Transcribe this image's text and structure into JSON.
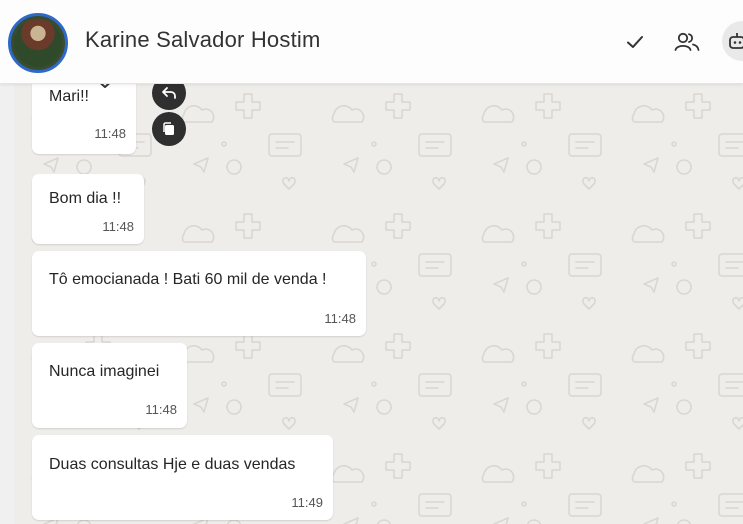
{
  "header": {
    "contact_name": "Karine Salvador Hostim",
    "avatar": "contact-avatar",
    "actions": [
      "check-icon",
      "group-icon",
      "bot-icon"
    ]
  },
  "messages": [
    {
      "text": "Mari!!",
      "time": "11:48"
    },
    {
      "text": "Bom dia !!",
      "time": "11:48"
    },
    {
      "text": "Tô emocianada ! Bati 60 mil de venda !",
      "time": "11:48"
    },
    {
      "text": "Nunca imaginei",
      "time": "11:48"
    },
    {
      "text": "Duas consultas Hje e duas vendas",
      "time": "11:49"
    }
  ],
  "floating_actions": [
    "reply-icon",
    "copy-icon"
  ],
  "colors": {
    "chat_bg": "#efedea",
    "bubble": "#ffffff",
    "avatar_ring": "#2d69c8",
    "fab": "#2f2f2f"
  }
}
